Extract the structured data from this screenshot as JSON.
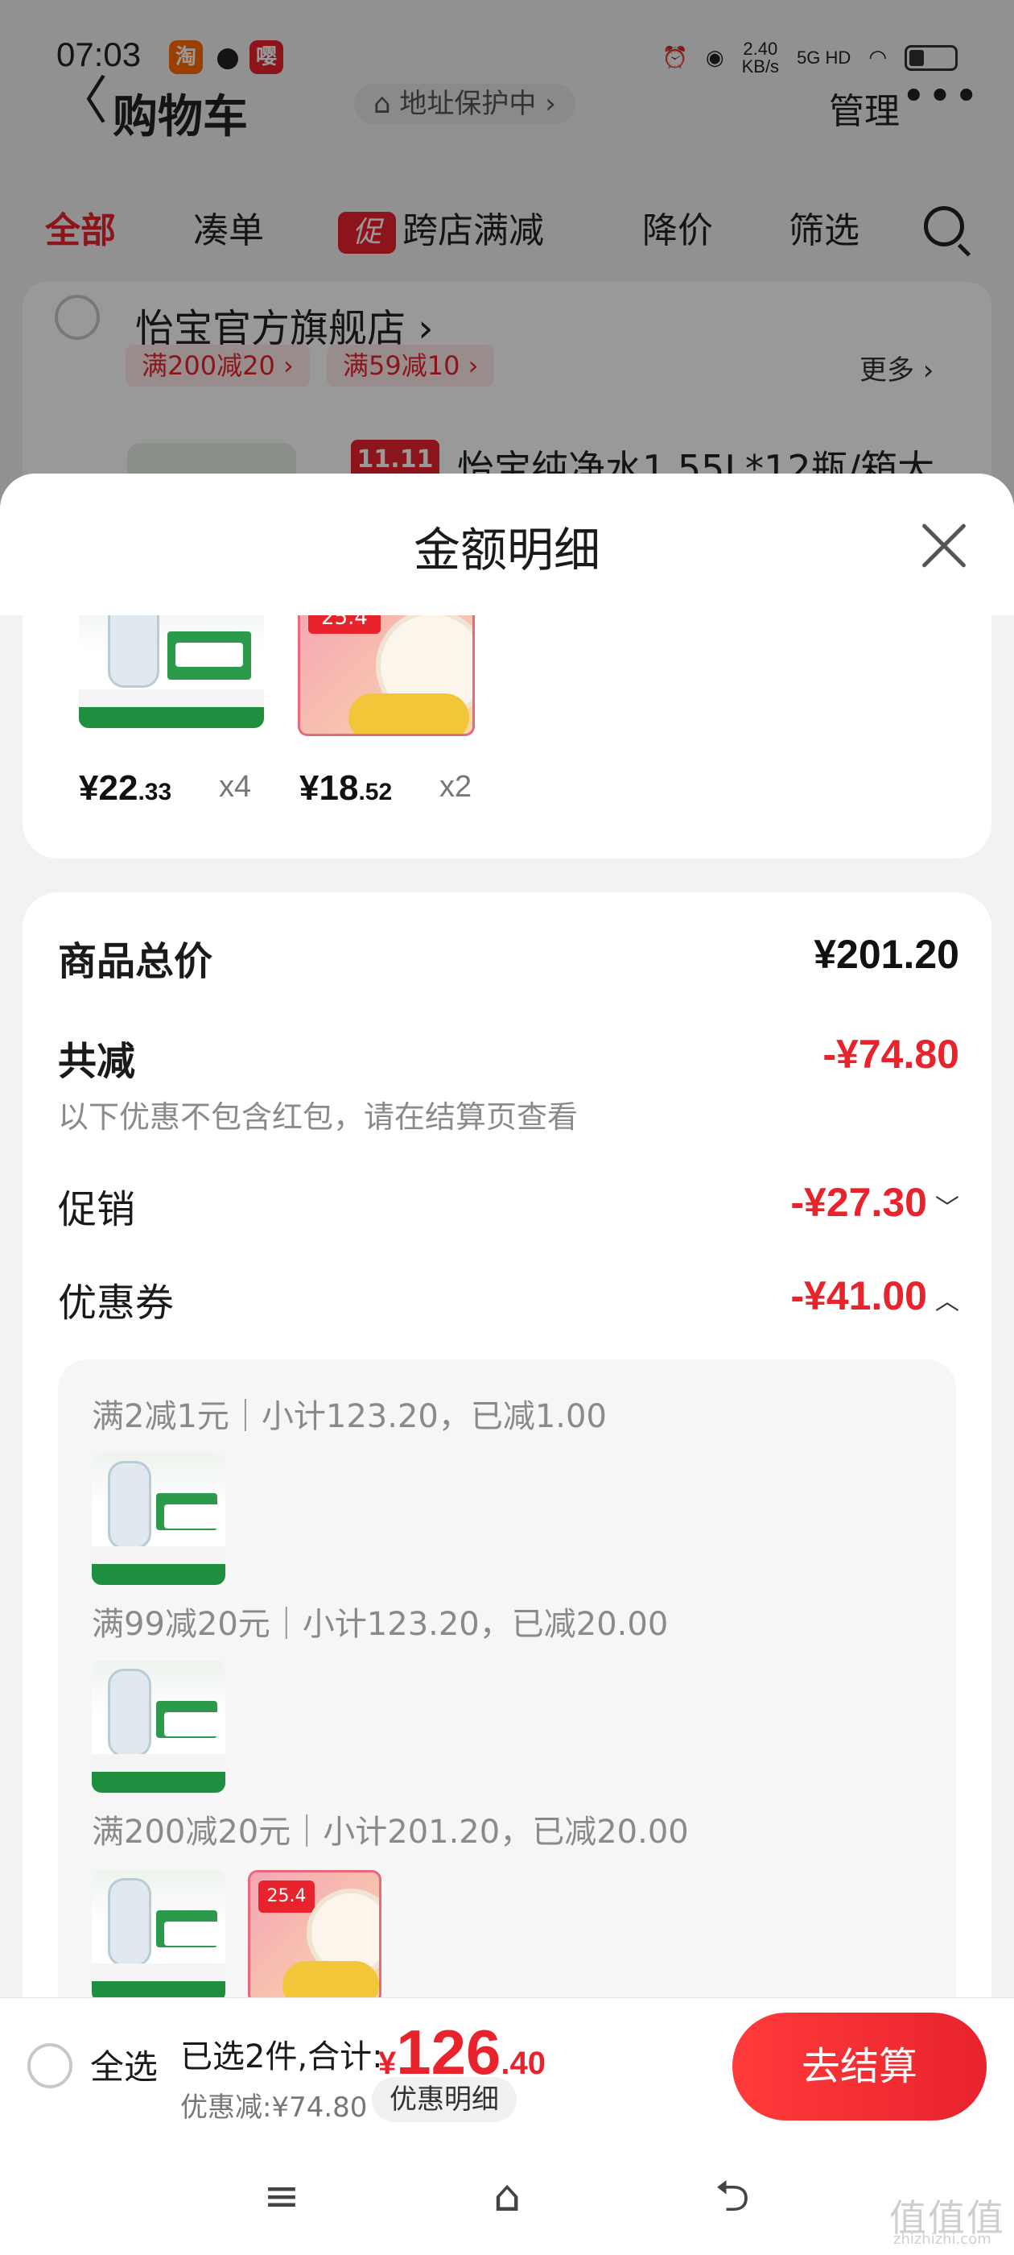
{
  "status_bar": {
    "time": "07:03",
    "app_icons": [
      "taobao-icon",
      "message-icon",
      "app-icon"
    ],
    "network_speed": "2.40\nKB/s",
    "network_type": "5G HD"
  },
  "cart_page": {
    "back_glyph": "〈",
    "title": "购物车",
    "address_protect": "⌂ 地址保护中 ›",
    "manage_label": "管理",
    "more_glyph": "•••",
    "tabs": [
      {
        "label": "全部",
        "active": true
      },
      {
        "label": "凑单"
      },
      {
        "label": "跨店满减",
        "badge": "促"
      },
      {
        "label": "降价"
      },
      {
        "label": "筛选"
      }
    ],
    "store": {
      "name": "怡宝官方旗舰店",
      "name_arrow": "›",
      "coupons": [
        "满200减20 ›",
        "满59减10 ›"
      ],
      "more_label": "更多 ›",
      "d11_badge": "11.11",
      "product_title": "怡宝纯净水1.55L*12瓶/箱大"
    }
  },
  "sheet": {
    "title": "金额明细",
    "products": [
      {
        "price_symbol": "¥",
        "price_int": "22",
        "price_dec": ".33",
        "qty": "x4"
      },
      {
        "price_symbol": "¥",
        "price_int": "18",
        "price_dec": ".52",
        "qty": "x2"
      }
    ],
    "summary": {
      "total_label": "商品总价",
      "total_value": "¥201.20",
      "reduce_label": "共减",
      "reduce_value": "-¥74.80",
      "reduce_note": "以下优惠不包含红包，请在结算页查看",
      "promo_label": "促销",
      "promo_value": "-¥27.30",
      "promo_chevron": "﹀",
      "coupon_label": "优惠券",
      "coupon_value": "-¥41.00",
      "coupon_chevron": "︿"
    },
    "coupon_details": [
      {
        "text": "满2减1元｜小计123.20，已减1.00"
      },
      {
        "text": "满99减20元｜小计123.20，已减20.00"
      },
      {
        "text": "满200减20元｜小计201.20，已减20.00"
      }
    ]
  },
  "checkout": {
    "select_all_label": "全选",
    "selected_text": "已选2件,合计:",
    "total_currency": "¥",
    "total_int": "126",
    "total_dec": ".40",
    "discount_text": "优惠减:¥74.80",
    "detail_pill": "优惠明细",
    "checkout_button": "去结算"
  },
  "nav_bar": {
    "menu_glyph": "≡",
    "home_glyph": "⌂",
    "back_glyph": "⮌"
  },
  "watermark": {
    "text": "值值值",
    "sub": "zhizhizhi.com"
  },
  "colors": {
    "accent_red": "#e8232c",
    "text_primary": "#1a1a1a",
    "text_secondary": "#8a8a8a",
    "sheet_bg": "#f2f2f2"
  }
}
